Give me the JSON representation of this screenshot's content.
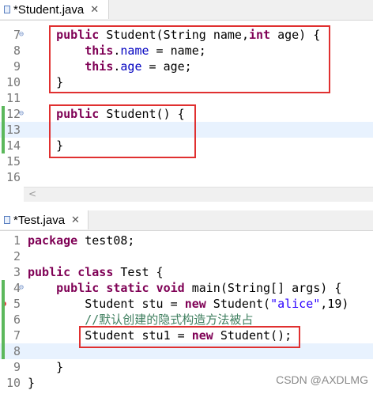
{
  "editor1": {
    "tab_title": "*Student.java",
    "close_glyph": "✕",
    "lines": [
      {
        "n": "7",
        "fold": true,
        "tokens": [
          {
            "t": "    ",
            "c": ""
          },
          {
            "t": "public",
            "c": "kw"
          },
          {
            "t": " Student(String ",
            "c": ""
          },
          {
            "t": "name",
            "c": ""
          },
          {
            "t": ",",
            "c": ""
          },
          {
            "t": "int",
            "c": "kw"
          },
          {
            "t": " age) {",
            "c": ""
          }
        ]
      },
      {
        "n": "8",
        "tokens": [
          {
            "t": "        ",
            "c": ""
          },
          {
            "t": "this",
            "c": "kw"
          },
          {
            "t": ".",
            "c": ""
          },
          {
            "t": "name",
            "c": "fld"
          },
          {
            "t": " = name;",
            "c": ""
          }
        ]
      },
      {
        "n": "9",
        "tokens": [
          {
            "t": "        ",
            "c": ""
          },
          {
            "t": "this",
            "c": "kw"
          },
          {
            "t": ".",
            "c": ""
          },
          {
            "t": "age",
            "c": "fld"
          },
          {
            "t": " = age;",
            "c": ""
          }
        ]
      },
      {
        "n": "10",
        "tokens": [
          {
            "t": "    }",
            "c": ""
          }
        ]
      },
      {
        "n": "11",
        "tokens": []
      },
      {
        "n": "12",
        "fold": true,
        "tokens": [
          {
            "t": "    ",
            "c": ""
          },
          {
            "t": "public",
            "c": "kw"
          },
          {
            "t": " Student() {",
            "c": ""
          }
        ]
      },
      {
        "n": "13",
        "current": true,
        "tokens": []
      },
      {
        "n": "14",
        "tokens": [
          {
            "t": "    }",
            "c": ""
          }
        ]
      },
      {
        "n": "15",
        "tokens": []
      },
      {
        "n": "16",
        "tokens": []
      }
    ]
  },
  "editor2": {
    "tab_title": "*Test.java",
    "close_glyph": "✕",
    "lines": [
      {
        "n": "1",
        "tokens": [
          {
            "t": "package",
            "c": "kw"
          },
          {
            "t": " test08;",
            "c": ""
          }
        ]
      },
      {
        "n": "2",
        "tokens": []
      },
      {
        "n": "3",
        "tokens": [
          {
            "t": "public",
            "c": "kw"
          },
          {
            "t": " ",
            "c": ""
          },
          {
            "t": "class",
            "c": "kw"
          },
          {
            "t": " Test {",
            "c": ""
          }
        ]
      },
      {
        "n": "4",
        "fold": true,
        "tokens": [
          {
            "t": "    ",
            "c": ""
          },
          {
            "t": "public",
            "c": "kw"
          },
          {
            "t": " ",
            "c": ""
          },
          {
            "t": "static",
            "c": "kw"
          },
          {
            "t": " ",
            "c": ""
          },
          {
            "t": "void",
            "c": "kw"
          },
          {
            "t": " main(String[] args) {",
            "c": ""
          }
        ]
      },
      {
        "n": "5",
        "error": true,
        "tokens": [
          {
            "t": "        Student stu = ",
            "c": ""
          },
          {
            "t": "new",
            "c": "kw"
          },
          {
            "t": " Student(",
            "c": ""
          },
          {
            "t": "\"alice\"",
            "c": "str"
          },
          {
            "t": ",19)",
            "c": ""
          }
        ]
      },
      {
        "n": "6",
        "tokens": [
          {
            "t": "        ",
            "c": ""
          },
          {
            "t": "//默认创建的隐式构造方法被占",
            "c": "cmt"
          }
        ]
      },
      {
        "n": "7",
        "tokens": [
          {
            "t": "        Student stu1 = ",
            "c": ""
          },
          {
            "t": "new",
            "c": "kw"
          },
          {
            "t": " Student();",
            "c": ""
          }
        ]
      },
      {
        "n": "8",
        "current": true,
        "tokens": []
      },
      {
        "n": "9",
        "tokens": [
          {
            "t": "    }",
            "c": ""
          }
        ]
      },
      {
        "n": "10",
        "tokens": [
          {
            "t": "}",
            "c": ""
          }
        ]
      }
    ]
  },
  "watermark": "CSDN @AXDLMG",
  "scroll_arrow": "<"
}
